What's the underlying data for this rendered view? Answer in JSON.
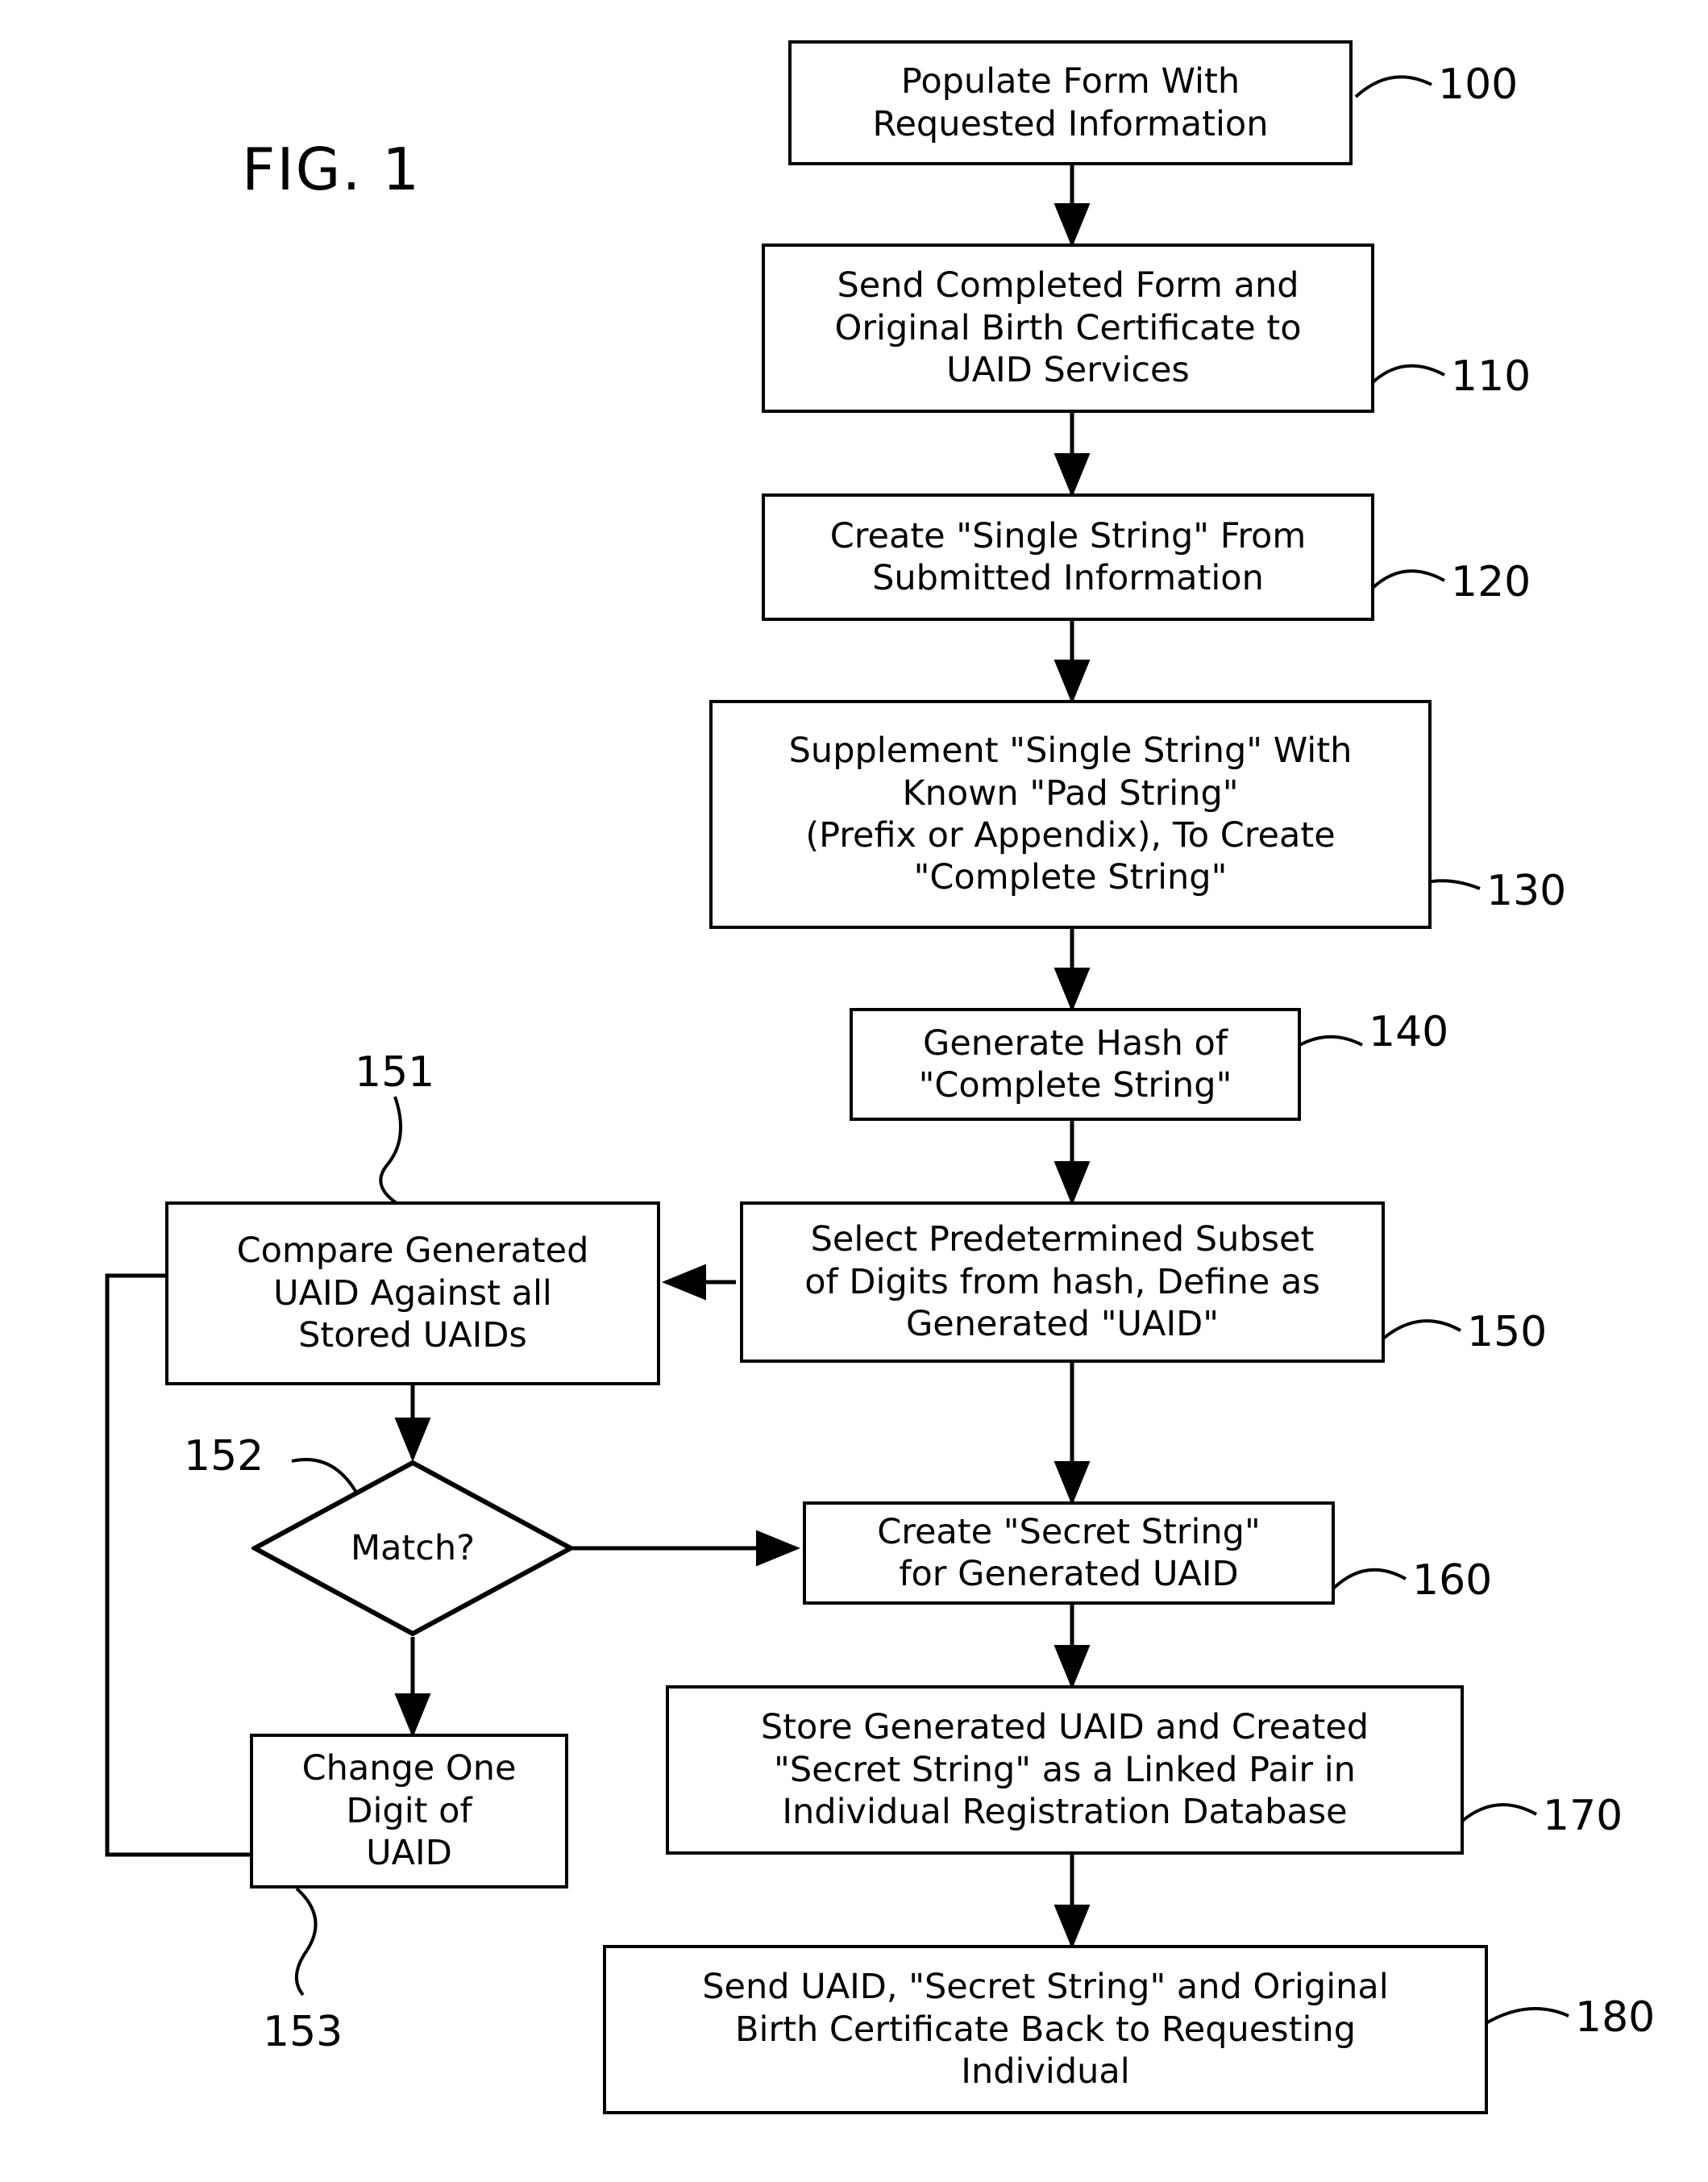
{
  "figure": {
    "title": "FIG. 1"
  },
  "nodes": [
    {
      "id": "populate-form",
      "ref": "100",
      "text": "Populate Form With\nRequested Information",
      "shape": "process"
    },
    {
      "id": "send-form",
      "ref": "110",
      "text": "Send Completed Form and\nOriginal Birth Certificate to\nUAID Services",
      "shape": "process"
    },
    {
      "id": "create-single-string",
      "ref": "120",
      "text": "Create \"Single String\" From\nSubmitted Information",
      "shape": "process"
    },
    {
      "id": "supplement-pad-string",
      "ref": "130",
      "text": "Supplement \"Single String\" With\nKnown \"Pad String\"\n(Prefix or Appendix), To Create\n\"Complete String\"",
      "shape": "process"
    },
    {
      "id": "generate-hash",
      "ref": "140",
      "text": "Generate Hash of\n\"Complete String\"",
      "shape": "process"
    },
    {
      "id": "select-subset",
      "ref": "150",
      "text": "Select Predetermined Subset\nof Digits from hash, Define as\nGenerated \"UAID\"",
      "shape": "process"
    },
    {
      "id": "compare-uaid",
      "ref": "151",
      "text": "Compare Generated\nUAID Against all\nStored UAIDs",
      "shape": "process"
    },
    {
      "id": "match-decision",
      "ref": "152",
      "text": "Match?",
      "shape": "decision"
    },
    {
      "id": "change-digit",
      "ref": "153",
      "text": "Change One\nDigit of\nUAID",
      "shape": "process"
    },
    {
      "id": "create-secret-string",
      "ref": "160",
      "text": "Create \"Secret String\"\nfor Generated UAID",
      "shape": "process"
    },
    {
      "id": "store-pair",
      "ref": "170",
      "text": "Store Generated UAID and Created\n\"Secret String\" as a Linked Pair in\nIndividual Registration Database",
      "shape": "process"
    },
    {
      "id": "send-back",
      "ref": "180",
      "text": "Send UAID, \"Secret String\" and Original\nBirth Certificate Back to Requesting\nIndividual",
      "shape": "process"
    }
  ],
  "refs": {
    "n100": "100",
    "n110": "110",
    "n120": "120",
    "n130": "130",
    "n140": "140",
    "n150": "150",
    "n151": "151",
    "n152": "152",
    "n153": "153",
    "n160": "160",
    "n170": "170",
    "n180": "180"
  },
  "colors": {
    "ink": "#000000",
    "paper": "#ffffff"
  }
}
